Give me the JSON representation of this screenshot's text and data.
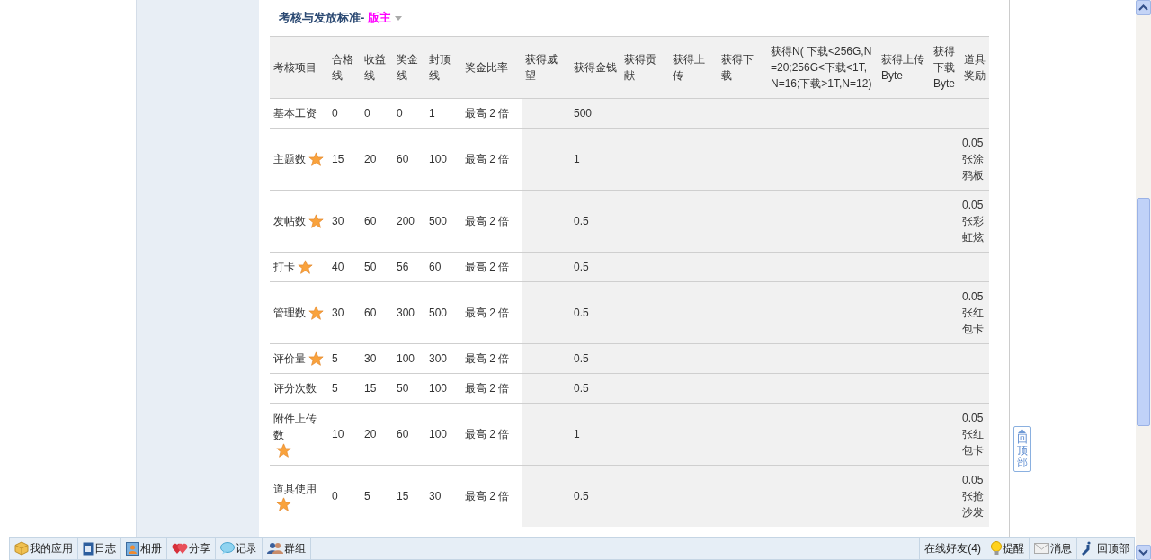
{
  "section": {
    "title": "考核与发放标准-",
    "role": "版主"
  },
  "table": {
    "columns": [
      "考核项目",
      "合格线",
      "收益线",
      "奖金线",
      "封顶线",
      "奖金比率",
      "获得威望",
      "获得金钱",
      "获得贡献",
      "获得上传",
      "获得下载",
      "获得N( 下载<256G,N=20;256G<下载<1T,N=16;下载>1T,N=12)",
      "获得上传Byte",
      "获得下载Byte",
      "道具奖励"
    ],
    "rows": [
      {
        "item": "基本工资",
        "star": false,
        "pass": "0",
        "income": "0",
        "bonus": "0",
        "cap": "1",
        "ratio": "最高 2 倍",
        "money": "500"
      },
      {
        "item": "主题数",
        "star": true,
        "pass": "15",
        "income": "20",
        "bonus": "60",
        "cap": "100",
        "ratio": "最高 2 倍",
        "money": "1",
        "reward": "0.05张涂鸦板"
      },
      {
        "item": "发帖数",
        "star": true,
        "pass": "30",
        "income": "60",
        "bonus": "200",
        "cap": "500",
        "ratio": "最高 2 倍",
        "money": "0.5",
        "reward": "0.05张彩虹炫"
      },
      {
        "item": "打卡",
        "star": true,
        "pass": "40",
        "income": "50",
        "bonus": "56",
        "cap": "60",
        "ratio": "最高 2 倍",
        "money": "0.5"
      },
      {
        "item": "管理数",
        "star": true,
        "pass": "30",
        "income": "60",
        "bonus": "300",
        "cap": "500",
        "ratio": "最高 2 倍",
        "money": "0.5",
        "reward": "0.05张红包卡"
      },
      {
        "item": "评价量",
        "star": true,
        "pass": "5",
        "income": "30",
        "bonus": "100",
        "cap": "300",
        "ratio": "最高 2 倍",
        "money": "0.5"
      },
      {
        "item": "评分次数",
        "star": false,
        "pass": "5",
        "income": "15",
        "bonus": "50",
        "cap": "100",
        "ratio": "最高 2 倍",
        "money": "0.5"
      },
      {
        "item": "附件上传数",
        "star": true,
        "pass": "10",
        "income": "20",
        "bonus": "60",
        "cap": "100",
        "ratio": "最高 2 倍",
        "money": "1",
        "reward": "0.05张红包卡"
      },
      {
        "item": "道具使用",
        "star": true,
        "pass": "0",
        "income": "5",
        "bonus": "15",
        "cap": "30",
        "ratio": "最高 2 倍",
        "money": "0.5",
        "reward": "0.05张抢沙发"
      }
    ]
  },
  "back_to_top": "回顶部",
  "toolbar": {
    "left": [
      {
        "label": "我的应用",
        "kind": "box"
      },
      {
        "label": "日志",
        "kind": "book"
      },
      {
        "label": "相册",
        "kind": "photo"
      },
      {
        "label": "分享",
        "kind": "heart"
      },
      {
        "label": "记录",
        "kind": "bubble"
      },
      {
        "label": "群组",
        "kind": "people"
      }
    ],
    "right": [
      {
        "label": "在线好友(4)",
        "kind": "plain"
      },
      {
        "label": "提醒",
        "kind": "bulb"
      },
      {
        "label": "消息",
        "kind": "mail"
      },
      {
        "label": "回顶部",
        "kind": "lift"
      }
    ]
  }
}
